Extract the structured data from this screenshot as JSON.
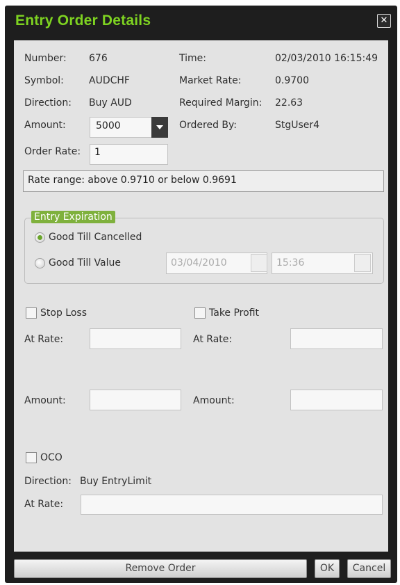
{
  "window": {
    "title": "Entry Order Details"
  },
  "info": {
    "number_label": "Number:",
    "number_value": "676",
    "symbol_label": "Symbol:",
    "symbol_value": "AUDCHF",
    "direction_label": "Direction:",
    "direction_value": "Buy AUD",
    "amount_label": "Amount:",
    "amount_value": "5000",
    "time_label": "Time:",
    "time_value": "02/03/2010 16:15:49",
    "market_rate_label": "Market Rate:",
    "market_rate_value": "0.9700",
    "required_margin_label": "Required Margin:",
    "required_margin_value": "22.63",
    "ordered_by_label": "Ordered By:",
    "ordered_by_value": "StgUser4"
  },
  "order_rate": {
    "label": "Order Rate:",
    "value": "1"
  },
  "rate_range": "Rate range: above 0.9710 or below 0.9691",
  "expiration": {
    "legend": "Entry Expiration",
    "good_till_cancelled": "Good Till Cancelled",
    "good_till_value": "Good Till Value",
    "date_value": "03/04/2010",
    "time_value": "15:36"
  },
  "stop_loss": {
    "label": "Stop Loss",
    "at_rate_label": "At Rate:",
    "amount_label": "Amount:"
  },
  "take_profit": {
    "label": "Take Profit",
    "at_rate_label": "At Rate:",
    "amount_label": "Amount:"
  },
  "oco": {
    "label": "OCO",
    "direction_label": "Direction:",
    "direction_value": "Buy EntryLimit",
    "at_rate_label": "At Rate:"
  },
  "buttons": {
    "remove": "Remove Order",
    "ok": "OK",
    "cancel": "Cancel"
  }
}
